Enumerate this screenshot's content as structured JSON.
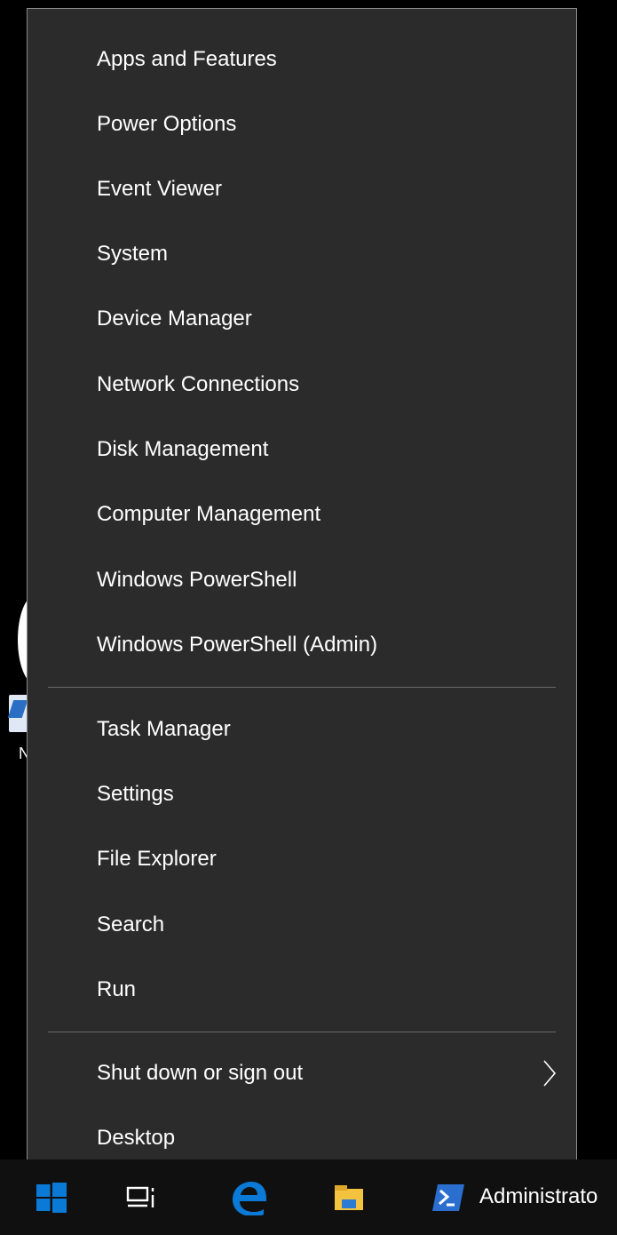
{
  "menu": {
    "group1": [
      "Apps and Features",
      "Power Options",
      "Event Viewer",
      "System",
      "Device Manager",
      "Network Connections",
      "Disk Management",
      "Computer Management",
      "Windows PowerShell",
      "Windows PowerShell (Admin)"
    ],
    "group2": [
      "Task Manager",
      "Settings",
      "File Explorer",
      "Search",
      "Run"
    ],
    "group3": {
      "shutdown": "Shut down or sign out",
      "desktop": "Desktop"
    }
  },
  "desktop": {
    "partial_label": "N"
  },
  "taskbar": {
    "active_window_label": "Administrato",
    "icons": [
      "windows-start-icon",
      "task-view-icon",
      "edge-icon",
      "file-explorer-icon",
      "powershell-icon"
    ]
  },
  "colors": {
    "menu_background": "#2b2b2b",
    "menu_text": "#ffffff",
    "taskbar_background": "#101010",
    "windows_blue": "#0a7ad6"
  }
}
